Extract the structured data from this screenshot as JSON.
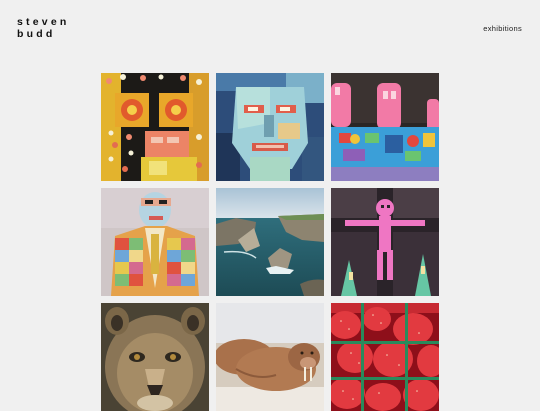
{
  "site": {
    "logo_line1": "steven",
    "logo_line2": "budd"
  },
  "nav": {
    "exhibitions": "exhibitions"
  },
  "gallery": {
    "items": [
      {
        "subject": "painting-orange-face-bubbles"
      },
      {
        "subject": "painting-blue-cubist-face"
      },
      {
        "subject": "painting-pink-figures-blue-house"
      },
      {
        "subject": "painting-patchwork-coat-figure"
      },
      {
        "subject": "photo-coastal-sea-cliffs"
      },
      {
        "subject": "painting-pink-crucifix-figure"
      },
      {
        "subject": "photo-lioness-closeup"
      },
      {
        "subject": "photo-walruses-on-beach"
      },
      {
        "subject": "photo-strawberries"
      }
    ]
  },
  "colors": {
    "background": "#f0f0f0",
    "text": "#111111"
  }
}
